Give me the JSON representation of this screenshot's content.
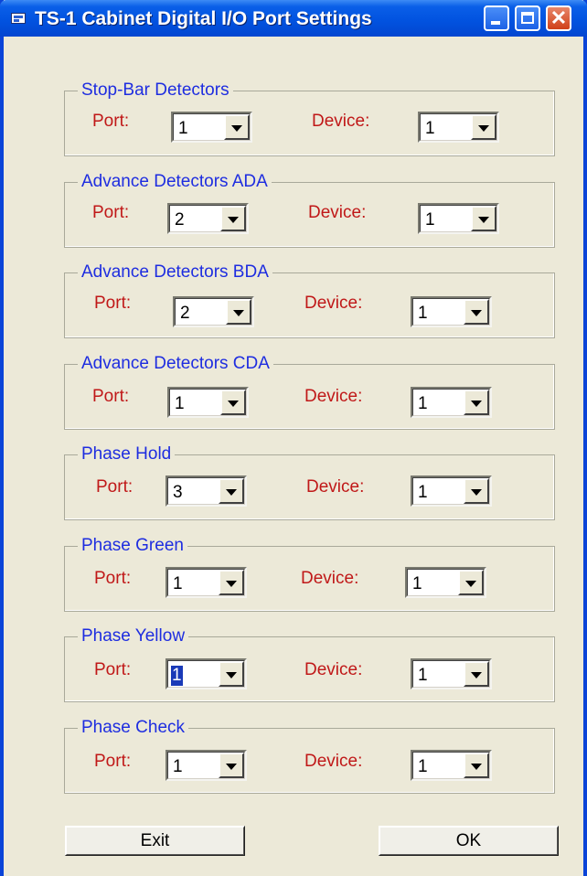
{
  "window": {
    "title": "TS-1 Cabinet Digital I/O Port Settings"
  },
  "labels": {
    "port": "Port:",
    "device": "Device:"
  },
  "groups": [
    {
      "title": "Stop-Bar Detectors",
      "port": "1",
      "device": "1"
    },
    {
      "title": "Advance Detectors ADA",
      "port": "2",
      "device": "1"
    },
    {
      "title": "Advance Detectors BDA",
      "port": "2",
      "device": "1"
    },
    {
      "title": "Advance Detectors CDA",
      "port": "1",
      "device": "1"
    },
    {
      "title": "Phase Hold",
      "port": "3",
      "device": "1"
    },
    {
      "title": "Phase Green",
      "port": "1",
      "device": "1"
    },
    {
      "title": "Phase Yellow",
      "port": "1",
      "device": "1"
    },
    {
      "title": "Phase Check",
      "port": "1",
      "device": "1"
    }
  ],
  "buttons": {
    "exit": "Exit",
    "ok": "OK"
  },
  "colors": {
    "group_title": "#1e2de0",
    "field_label": "#c01818",
    "titlebar": "#0253e0"
  }
}
